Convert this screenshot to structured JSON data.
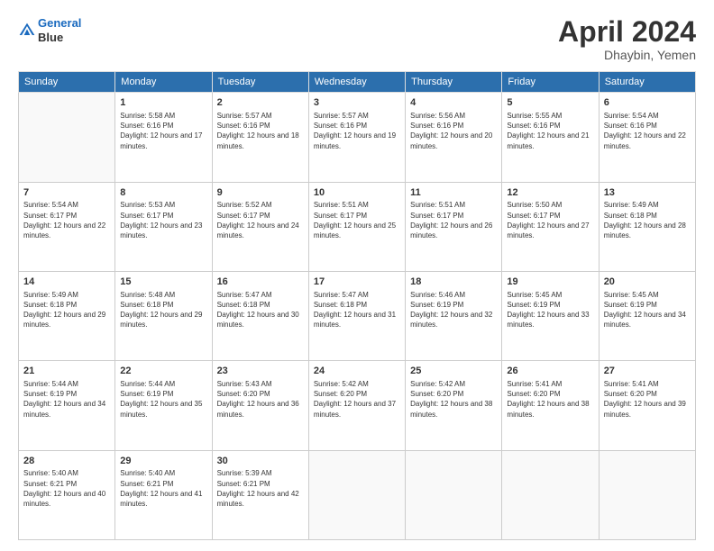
{
  "header": {
    "logo_line1": "General",
    "logo_line2": "Blue",
    "title": "April 2024",
    "location": "Dhaybin, Yemen"
  },
  "weekdays": [
    "Sunday",
    "Monday",
    "Tuesday",
    "Wednesday",
    "Thursday",
    "Friday",
    "Saturday"
  ],
  "weeks": [
    [
      {
        "day": "",
        "sunrise": "",
        "sunset": "",
        "daylight": ""
      },
      {
        "day": "1",
        "sunrise": "Sunrise: 5:58 AM",
        "sunset": "Sunset: 6:16 PM",
        "daylight": "Daylight: 12 hours and 17 minutes."
      },
      {
        "day": "2",
        "sunrise": "Sunrise: 5:57 AM",
        "sunset": "Sunset: 6:16 PM",
        "daylight": "Daylight: 12 hours and 18 minutes."
      },
      {
        "day": "3",
        "sunrise": "Sunrise: 5:57 AM",
        "sunset": "Sunset: 6:16 PM",
        "daylight": "Daylight: 12 hours and 19 minutes."
      },
      {
        "day": "4",
        "sunrise": "Sunrise: 5:56 AM",
        "sunset": "Sunset: 6:16 PM",
        "daylight": "Daylight: 12 hours and 20 minutes."
      },
      {
        "day": "5",
        "sunrise": "Sunrise: 5:55 AM",
        "sunset": "Sunset: 6:16 PM",
        "daylight": "Daylight: 12 hours and 21 minutes."
      },
      {
        "day": "6",
        "sunrise": "Sunrise: 5:54 AM",
        "sunset": "Sunset: 6:16 PM",
        "daylight": "Daylight: 12 hours and 22 minutes."
      }
    ],
    [
      {
        "day": "7",
        "sunrise": "Sunrise: 5:54 AM",
        "sunset": "Sunset: 6:17 PM",
        "daylight": "Daylight: 12 hours and 22 minutes."
      },
      {
        "day": "8",
        "sunrise": "Sunrise: 5:53 AM",
        "sunset": "Sunset: 6:17 PM",
        "daylight": "Daylight: 12 hours and 23 minutes."
      },
      {
        "day": "9",
        "sunrise": "Sunrise: 5:52 AM",
        "sunset": "Sunset: 6:17 PM",
        "daylight": "Daylight: 12 hours and 24 minutes."
      },
      {
        "day": "10",
        "sunrise": "Sunrise: 5:51 AM",
        "sunset": "Sunset: 6:17 PM",
        "daylight": "Daylight: 12 hours and 25 minutes."
      },
      {
        "day": "11",
        "sunrise": "Sunrise: 5:51 AM",
        "sunset": "Sunset: 6:17 PM",
        "daylight": "Daylight: 12 hours and 26 minutes."
      },
      {
        "day": "12",
        "sunrise": "Sunrise: 5:50 AM",
        "sunset": "Sunset: 6:17 PM",
        "daylight": "Daylight: 12 hours and 27 minutes."
      },
      {
        "day": "13",
        "sunrise": "Sunrise: 5:49 AM",
        "sunset": "Sunset: 6:18 PM",
        "daylight": "Daylight: 12 hours and 28 minutes."
      }
    ],
    [
      {
        "day": "14",
        "sunrise": "Sunrise: 5:49 AM",
        "sunset": "Sunset: 6:18 PM",
        "daylight": "Daylight: 12 hours and 29 minutes."
      },
      {
        "day": "15",
        "sunrise": "Sunrise: 5:48 AM",
        "sunset": "Sunset: 6:18 PM",
        "daylight": "Daylight: 12 hours and 29 minutes."
      },
      {
        "day": "16",
        "sunrise": "Sunrise: 5:47 AM",
        "sunset": "Sunset: 6:18 PM",
        "daylight": "Daylight: 12 hours and 30 minutes."
      },
      {
        "day": "17",
        "sunrise": "Sunrise: 5:47 AM",
        "sunset": "Sunset: 6:18 PM",
        "daylight": "Daylight: 12 hours and 31 minutes."
      },
      {
        "day": "18",
        "sunrise": "Sunrise: 5:46 AM",
        "sunset": "Sunset: 6:19 PM",
        "daylight": "Daylight: 12 hours and 32 minutes."
      },
      {
        "day": "19",
        "sunrise": "Sunrise: 5:45 AM",
        "sunset": "Sunset: 6:19 PM",
        "daylight": "Daylight: 12 hours and 33 minutes."
      },
      {
        "day": "20",
        "sunrise": "Sunrise: 5:45 AM",
        "sunset": "Sunset: 6:19 PM",
        "daylight": "Daylight: 12 hours and 34 minutes."
      }
    ],
    [
      {
        "day": "21",
        "sunrise": "Sunrise: 5:44 AM",
        "sunset": "Sunset: 6:19 PM",
        "daylight": "Daylight: 12 hours and 34 minutes."
      },
      {
        "day": "22",
        "sunrise": "Sunrise: 5:44 AM",
        "sunset": "Sunset: 6:19 PM",
        "daylight": "Daylight: 12 hours and 35 minutes."
      },
      {
        "day": "23",
        "sunrise": "Sunrise: 5:43 AM",
        "sunset": "Sunset: 6:20 PM",
        "daylight": "Daylight: 12 hours and 36 minutes."
      },
      {
        "day": "24",
        "sunrise": "Sunrise: 5:42 AM",
        "sunset": "Sunset: 6:20 PM",
        "daylight": "Daylight: 12 hours and 37 minutes."
      },
      {
        "day": "25",
        "sunrise": "Sunrise: 5:42 AM",
        "sunset": "Sunset: 6:20 PM",
        "daylight": "Daylight: 12 hours and 38 minutes."
      },
      {
        "day": "26",
        "sunrise": "Sunrise: 5:41 AM",
        "sunset": "Sunset: 6:20 PM",
        "daylight": "Daylight: 12 hours and 38 minutes."
      },
      {
        "day": "27",
        "sunrise": "Sunrise: 5:41 AM",
        "sunset": "Sunset: 6:20 PM",
        "daylight": "Daylight: 12 hours and 39 minutes."
      }
    ],
    [
      {
        "day": "28",
        "sunrise": "Sunrise: 5:40 AM",
        "sunset": "Sunset: 6:21 PM",
        "daylight": "Daylight: 12 hours and 40 minutes."
      },
      {
        "day": "29",
        "sunrise": "Sunrise: 5:40 AM",
        "sunset": "Sunset: 6:21 PM",
        "daylight": "Daylight: 12 hours and 41 minutes."
      },
      {
        "day": "30",
        "sunrise": "Sunrise: 5:39 AM",
        "sunset": "Sunset: 6:21 PM",
        "daylight": "Daylight: 12 hours and 42 minutes."
      },
      {
        "day": "",
        "sunrise": "",
        "sunset": "",
        "daylight": ""
      },
      {
        "day": "",
        "sunrise": "",
        "sunset": "",
        "daylight": ""
      },
      {
        "day": "",
        "sunrise": "",
        "sunset": "",
        "daylight": ""
      },
      {
        "day": "",
        "sunrise": "",
        "sunset": "",
        "daylight": ""
      }
    ]
  ]
}
